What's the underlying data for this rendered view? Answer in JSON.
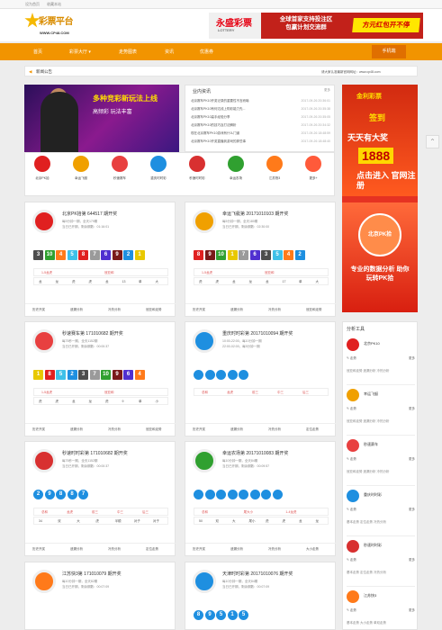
{
  "topbar": {
    "left1": "设为首页",
    "left2": "收藏本站"
  },
  "logo": {
    "title": "彩票平台",
    "sub": "WWW.CP48.COM"
  },
  "top_banner": {
    "brand": "永盛彩票",
    "brand_sub": "LOTTERY",
    "line1": "全球首家支持投注区",
    "line2": "包赢计划交流群",
    "red": "方元红包开不停"
  },
  "nav": {
    "items": [
      "首页",
      "彩票大厅 ▾",
      "走势图表",
      "资讯",
      "优惠券"
    ],
    "right": "手机端"
  },
  "notice": {
    "label": "新闻公告",
    "text": "请大家认准最新官网网址：www.cp48.com"
  },
  "promo": {
    "title": "多种竞彩新玩法上线",
    "sub": "高频彩 玩法丰富"
  },
  "news": {
    "title": "业内资讯",
    "more": "更多",
    "rows": [
      {
        "t": "北京赛车PK10开奖记录的重要性不言而喻",
        "d": "2017-09-26 20:36:01"
      },
      {
        "t": "北京赛车PK10有何达线上购彩能力先...",
        "d": "2017-09-26 20:35:38"
      },
      {
        "t": "北京赛车PK10高手经验分享",
        "d": "2017-09-26 20:35:05"
      },
      {
        "t": "北京赛车PK10的技巧及打法解析",
        "d": "2017-09-26 20:34:32"
      },
      {
        "t": "现在北京赛车PK10游戏有什么门道",
        "d": "2017-09-26 18:48:59"
      },
      {
        "t": "北京赛车PK10开奖直播到游戏的那些事",
        "d": "2017-09-26 18:48:40"
      }
    ]
  },
  "lotteries": [
    {
      "label": "北京PK拾",
      "color": "#e02020"
    },
    {
      "label": "幸运飞艇",
      "color": "#f0a000"
    },
    {
      "label": "秒速赛车",
      "color": "#e84040"
    },
    {
      "label": "重庆时时彩",
      "color": "#1e8fe0"
    },
    {
      "label": "秒速时时彩",
      "color": "#d83030"
    },
    {
      "label": "幸运农场",
      "color": "#30a030"
    },
    {
      "label": "江苏快3",
      "color": "#ff7a1a"
    },
    {
      "label": "更多+",
      "color": "#ff5a3a"
    }
  ],
  "side_ad": {
    "t1": "金利彩票",
    "t2": "签到",
    "t3": "天天有大奖",
    "t4": "1888",
    "t5": "点击进入 官网注册",
    "c": "北京PK拾",
    "t6": "专业的数据分析 助你玩转PK拾"
  },
  "games": [
    {
      "title": "北京PK拾第 644517 期开奖",
      "sub1": "每5分钟一期，全天179期",
      "sub2": "当日已开期，剩余期数：01:16:01",
      "balls": [
        "3",
        "10",
        "4",
        "5",
        "8",
        "7",
        "6",
        "9",
        "2",
        "1"
      ],
      "r1": [
        "1-5龙虎",
        "冠亚和"
      ],
      "r2": [
        "龙",
        "龙",
        "虎",
        "虎",
        "龙",
        "13",
        "单",
        "大"
      ],
      "foot": [
        "历史开奖",
        "遗漏分析",
        "冷热分析",
        "冠亚和走势"
      ]
    },
    {
      "title": "幸运飞艇第 20171010103 期开奖",
      "sub1": "每5分钟一期，全天180期",
      "sub2": "当日已开期，剩余期数：02:30:00",
      "balls": [
        "8",
        "9",
        "10",
        "1",
        "7",
        "6",
        "3",
        "5",
        "4",
        "2"
      ],
      "r1": [
        "1-5龙虎",
        "冠亚和"
      ],
      "r2": [
        "虎",
        "虎",
        "龙",
        "龙",
        "龙",
        "17",
        "单",
        "大"
      ],
      "foot": [
        "历史开奖",
        "遗漏分析",
        "冷热分析",
        "冠亚和走势"
      ]
    },
    {
      "title": "秒速赛车第 171010682 期开奖",
      "sub1": "每75秒一期，全天1152期",
      "sub2": "当日已开期，剩余期数：00:00:37",
      "balls": [
        "1",
        "8",
        "5",
        "2",
        "3",
        "7",
        "10",
        "9",
        "6",
        "4"
      ],
      "r1": [
        "1-5龙虎",
        "冠亚和"
      ],
      "r2": [
        "虎",
        "虎",
        "龙",
        "龙",
        "虎",
        "9",
        "单",
        "小"
      ],
      "foot": [
        "历史开奖",
        "遗漏分析",
        "冷热分析",
        "冠亚和走势"
      ]
    },
    {
      "title": "重庆时时彩第 20171010094 期开奖",
      "sub1": "10:00-22:00，每10分钟一期",
      "sub2": "22:00-02:00，每5分钟一期",
      "balls": [
        "",
        "",
        "",
        "",
        ""
      ],
      "r1": [
        "总和",
        "龙虎",
        "前三",
        "中三",
        "后三"
      ],
      "r2": [],
      "foot": [
        "历史开奖",
        "遗漏分析",
        "冷热分析",
        "定位走势"
      ]
    },
    {
      "title": "秒速时时彩第 171010682 期开奖",
      "sub1": "每75秒一期，全天1152期",
      "sub2": "当日已开期，剩余期数：00:00:37",
      "balls": [
        "2",
        "9",
        "8",
        "8",
        "7"
      ],
      "r1": [
        "总和",
        "龙虎",
        "前三",
        "中三",
        "后三"
      ],
      "r2": [
        "34",
        "双",
        "大",
        "虎",
        "半顺",
        "对子",
        "对子"
      ],
      "foot": [
        "历史开奖",
        "遗漏分析",
        "冷热分析",
        "定位走势"
      ]
    },
    {
      "title": "幸运农场第 20171010083 期开奖",
      "sub1": "每10分钟一期，全天84期",
      "sub2": "当日已开期，剩余期数：00:09:57",
      "balls": [
        "",
        "",
        "",
        "",
        "",
        "",
        "",
        ""
      ],
      "r1": [
        "总和",
        "尾大小",
        "1-4龙虎"
      ],
      "r2": [
        "50",
        "双",
        "大",
        "尾小",
        "虎",
        "虎",
        "龙",
        "龙"
      ],
      "foot": [
        "历史开奖",
        "遗漏分析",
        "冷热分析",
        "大小走势"
      ]
    },
    {
      "title": "江苏快3第 171010079 期开奖",
      "sub1": "每10分钟一期，全天82期",
      "sub2": "当日已开期，剩余期数：00:07:09",
      "balls": [],
      "r1": [],
      "r2": [],
      "foot": []
    },
    {
      "title": "天津时时彩第 20171010076 期开奖",
      "sub1": "每10分钟一期，全天84期",
      "sub2": "当日已开期，剩余期数：00:07:09",
      "balls": [
        "8",
        "9",
        "5",
        "1",
        "5"
      ],
      "r1": [],
      "r2": [],
      "foot": []
    }
  ],
  "tools": {
    "title": "分析工具",
    "items": [
      {
        "name": "北京PK10",
        "l1": "走势",
        "l1b": "更多",
        "l2": "冠亚和走势 遗漏分析 冷热分析",
        "color": "#e02020"
      },
      {
        "name": "幸运飞艇",
        "l1": "走势",
        "l1b": "更多",
        "l2": "冠亚和走势 遗漏分析 冷热分析",
        "color": "#f0a000"
      },
      {
        "name": "秒速赛车",
        "l1": "走势",
        "l1b": "更多",
        "l2": "冠亚和走势 遗漏分析 冷热分析",
        "color": "#e84040"
      },
      {
        "name": "重庆时时彩",
        "l1": "走势",
        "l1b": "更多",
        "l2": "基本走势 定位走势 冷热分析",
        "color": "#1e8fe0"
      },
      {
        "name": "秒速时时彩",
        "l1": "走势",
        "l1b": "更多",
        "l2": "基本走势 定位走势 冷热分析",
        "color": "#d83030"
      },
      {
        "name": "江苏快3",
        "l1": "走势",
        "l1b": "更多",
        "l2": "基本走势 大小走势 单双走势",
        "color": "#ff7a1a"
      }
    ]
  },
  "colors": {
    "accent": "#f29400"
  }
}
